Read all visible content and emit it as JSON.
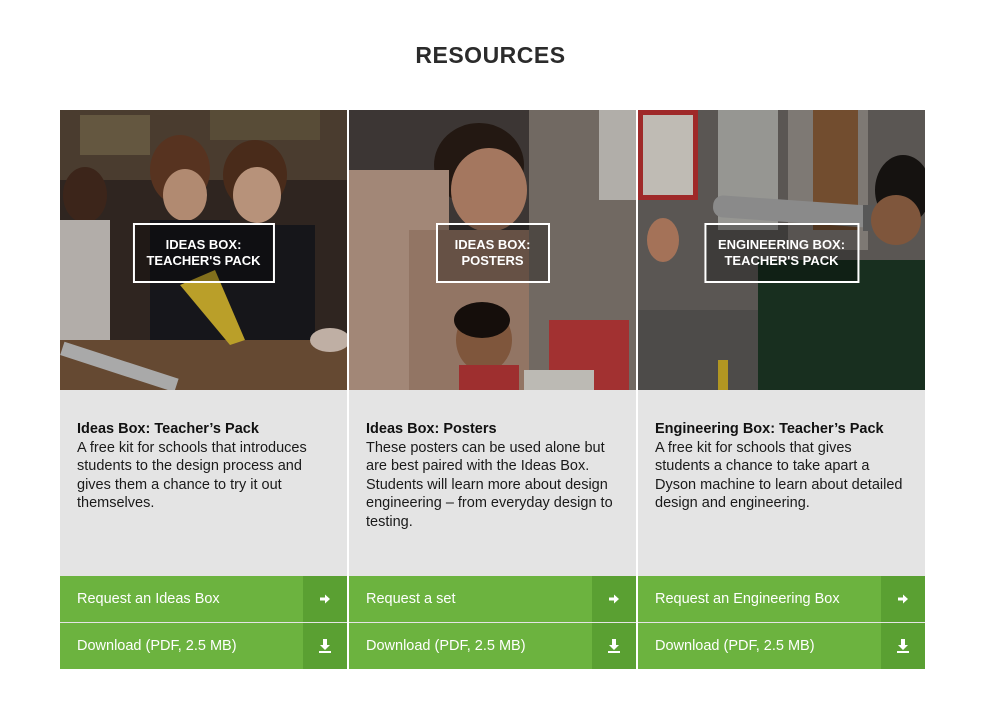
{
  "page": {
    "title": "RESOURCES"
  },
  "colors": {
    "accent": "#6cb33f",
    "accent_dark": "#5aa032",
    "card_bg": "#e4e4e4"
  },
  "cards": [
    {
      "hero_label": [
        "IDEAS BOX:",
        "TEACHER'S PACK"
      ],
      "title": "Ideas Box: Teacher’s Pack",
      "description": "A free kit for schools that introduces students to the design process and gives them a chance to try it out themselves.",
      "actions": [
        {
          "label": "Request an Ideas Box",
          "icon": "arrow-right-icon"
        },
        {
          "label": "Download (PDF, 2.5 MB)",
          "icon": "download-icon"
        }
      ]
    },
    {
      "hero_label": [
        "IDEAS BOX:",
        "POSTERS"
      ],
      "title": "Ideas Box: Posters",
      "description": "These posters can be used alone but are best paired with the Ideas Box. Students will learn more about design engineering – from everyday design to testing.",
      "actions": [
        {
          "label": "Request a set",
          "icon": "arrow-right-icon"
        },
        {
          "label": "Download (PDF, 2.5 MB)",
          "icon": "download-icon"
        }
      ]
    },
    {
      "hero_label": [
        "ENGINEERING BOX:",
        "TEACHER'S PACK"
      ],
      "title": "Engineering Box: Teacher’s Pack",
      "description": "A free kit for schools that gives students a chance to take apart a Dyson machine to learn about detailed design and engineering.",
      "actions": [
        {
          "label": "Request an Engineering Box",
          "icon": "arrow-right-icon"
        },
        {
          "label": "Download (PDF, 2.5 MB)",
          "icon": "download-icon"
        }
      ]
    }
  ]
}
